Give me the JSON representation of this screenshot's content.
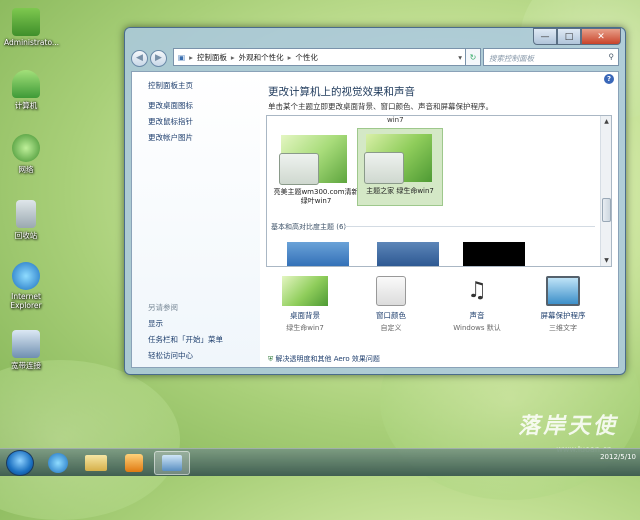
{
  "desktop": {
    "icons": [
      {
        "label": "Administrato...",
        "icon": "folder-icon"
      },
      {
        "label": "计算机",
        "icon": "computer-icon"
      },
      {
        "label": "网络",
        "icon": "network-icon"
      },
      {
        "label": "回收站",
        "icon": "recycle-bin-icon"
      },
      {
        "label": "Internet Explorer",
        "icon": "ie-icon"
      },
      {
        "label": "宽带连接",
        "icon": "broadband-icon"
      }
    ]
  },
  "window": {
    "address": {
      "parts": [
        "控制面板",
        "外观和个性化",
        "个性化"
      ],
      "search_placeholder": "搜索控制面板"
    },
    "sidebar": {
      "links": [
        "控制面板主页",
        "更改桌面图标",
        "更改鼠标指针",
        "更改帐户图片"
      ],
      "see_also_title": "另请参阅",
      "see_also": [
        "显示",
        "任务栏和「开始」菜单",
        "轻松访问中心"
      ]
    },
    "main": {
      "title": "更改计算机上的视觉效果和声音",
      "subtitle": "单击某个主题立即更改桌面背景、窗口颜色、声音和屏幕保护程序。",
      "top_label": "win7",
      "themes": [
        {
          "name": "亮美主题wm300.com清新绿叶win7",
          "selected": false
        },
        {
          "name": "主题之家 绿生命win7",
          "selected": true
        }
      ],
      "basic_group": "基本和高对比度主题 (6)"
    },
    "bottom": [
      {
        "label": "桌面背景",
        "value": "绿生命win7"
      },
      {
        "label": "窗口颜色",
        "value": "自定义"
      },
      {
        "label": "声音",
        "value": "Windows 默认"
      },
      {
        "label": "屏幕保护程序",
        "value": "三维文字"
      }
    ],
    "aero_link": "解决透明度和其他 Aero 效果问题"
  },
  "taskbar": {
    "time": "",
    "date": "2012/5/10"
  },
  "watermark": {
    "text": "落岸天使",
    "url": "www.luoan.cn"
  }
}
